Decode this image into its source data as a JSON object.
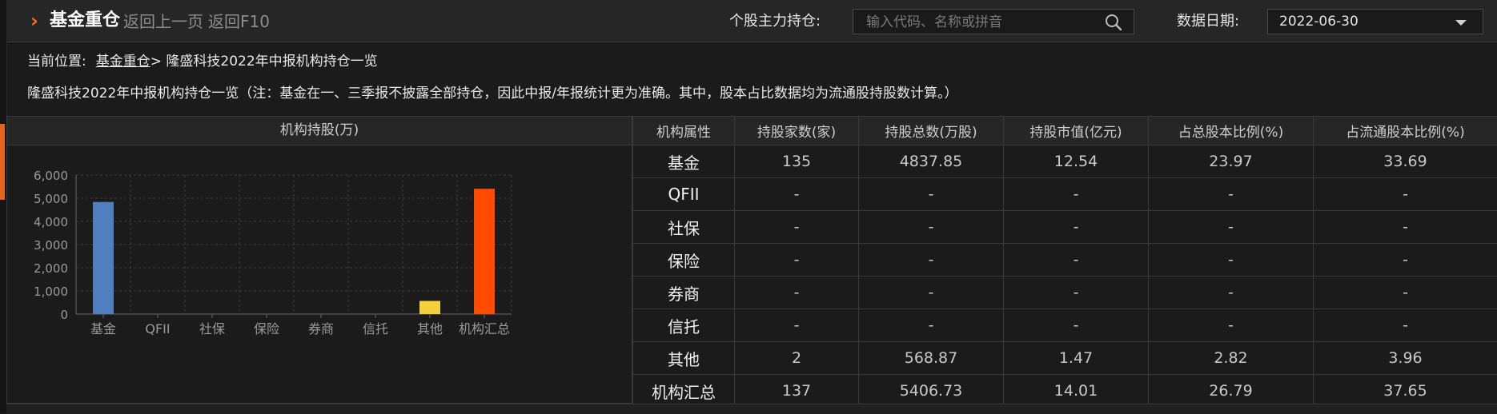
{
  "header": {
    "title": "基金重仓",
    "back_prev": "返回上一页",
    "back_f10": "返回F10",
    "stock_holding_label": "个股主力持仓:",
    "search_placeholder": "输入代码、名称或拼音",
    "date_label": "数据日期:",
    "date_value": "2022-06-30"
  },
  "breadcrumb": {
    "prefix": "当前位置:",
    "link": "基金重仓",
    "sep": ">",
    "current": "隆盛科技2022年中报机构持仓一览"
  },
  "note": "隆盛科技2022年中报机构持仓一览（注：基金在一、三季报不披露全部持仓，因此中报/年报统计更为准确。其中，股本占比数据均为流通股持股数计算。）",
  "chart_panel_title": "机构持股(万)",
  "chart_data": {
    "type": "bar",
    "title": "机构持股(万)",
    "categories": [
      "基金",
      "QFII",
      "社保",
      "保险",
      "券商",
      "信托",
      "其他",
      "机构汇总"
    ],
    "values": [
      4837.85,
      0,
      0,
      0,
      0,
      0,
      568.87,
      5406.73
    ],
    "colors": [
      "#4f7fbd",
      "#4f7fbd",
      "#4f7fbd",
      "#4f7fbd",
      "#4f7fbd",
      "#4f7fbd",
      "#f2d13a",
      "#ff4a00"
    ],
    "ylim": [
      0,
      6000
    ],
    "yticks": [
      "6,000",
      "5,000",
      "4,000",
      "3,000",
      "2,000",
      "1,000",
      "0"
    ],
    "ytick_values": [
      6000,
      5000,
      4000,
      3000,
      2000,
      1000,
      0
    ],
    "grid": true
  },
  "table": {
    "headers": [
      "机构属性",
      "持股家数(家)",
      "持股总数(万股)",
      "持股市值(亿元)",
      "占总股本比例(%)",
      "占流通股本比例(%)"
    ],
    "rows": [
      [
        "基金",
        "135",
        "4837.85",
        "12.54",
        "23.97",
        "33.69"
      ],
      [
        "QFII",
        "-",
        "-",
        "-",
        "-",
        "-"
      ],
      [
        "社保",
        "-",
        "-",
        "-",
        "-",
        "-"
      ],
      [
        "保险",
        "-",
        "-",
        "-",
        "-",
        "-"
      ],
      [
        "券商",
        "-",
        "-",
        "-",
        "-",
        "-"
      ],
      [
        "信托",
        "-",
        "-",
        "-",
        "-",
        "-"
      ],
      [
        "其他",
        "2",
        "568.87",
        "1.47",
        "2.82",
        "3.96"
      ],
      [
        "机构汇总",
        "137",
        "5406.73",
        "14.01",
        "26.79",
        "37.65"
      ]
    ]
  }
}
